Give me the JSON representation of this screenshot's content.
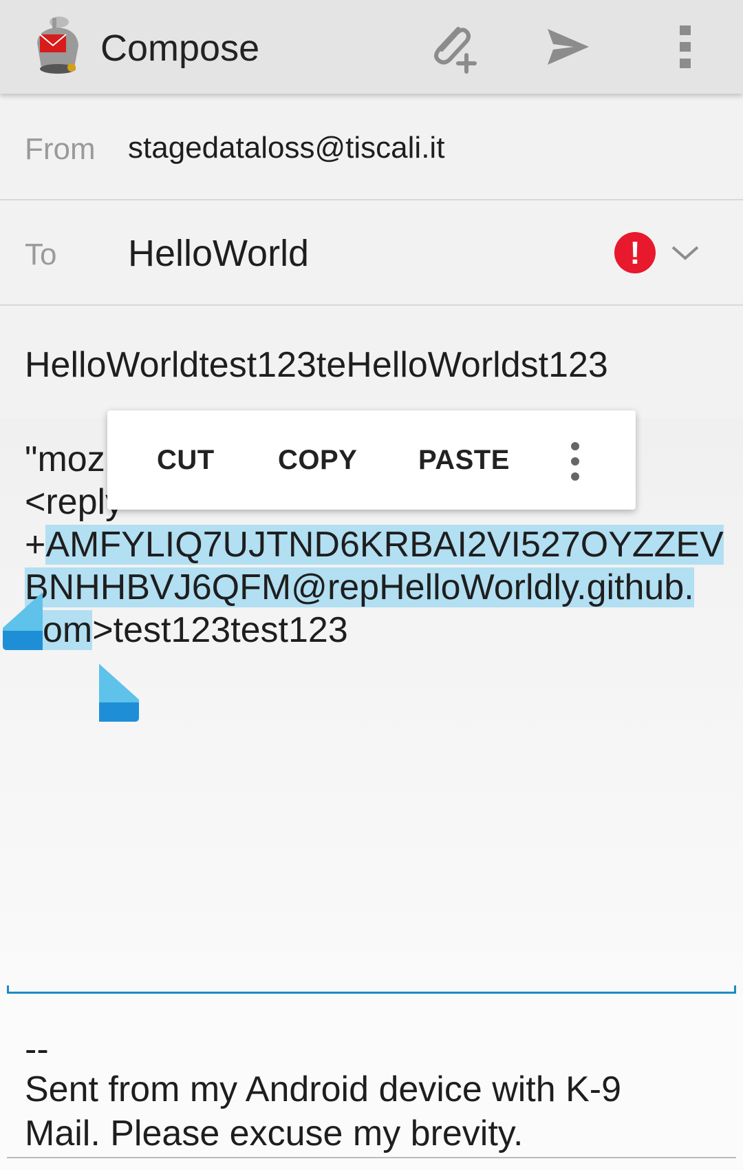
{
  "toolbar": {
    "title": "Compose",
    "icons": [
      "k9-mail-logo-icon",
      "attach-icon",
      "send-icon",
      "overflow-menu-icon"
    ]
  },
  "from": {
    "label": "From",
    "value": "stagedataloss@tiscali.it"
  },
  "to": {
    "label": "To",
    "value": "HelloWorld",
    "error_icon": "!"
  },
  "subject": {
    "value": "HelloWorldtest123teHelloWorldst123"
  },
  "body": {
    "line1": "\"moz",
    "line2": "<reply",
    "line3_plain": "+",
    "line3_sel": "AMFYLIQ7UJTND6KRBAI2VI527OYZZEV",
    "line4_sel": "BNHHBVJ6QFM@repHelloWorldly.github.",
    "line5_sel": "com",
    "line5_plain": ">test123test123"
  },
  "context_menu": {
    "cut": "CUT",
    "copy": "COPY",
    "paste": "PASTE"
  },
  "signature": {
    "dash": "--",
    "line1": "Sent from my Android device with K-9",
    "line2": "Mail. Please excuse my brevity."
  },
  "colors": {
    "selection": "#b2dff2",
    "handle": "#1e8fd6",
    "error": "#e8192c",
    "accent": "#1a8cc4"
  }
}
